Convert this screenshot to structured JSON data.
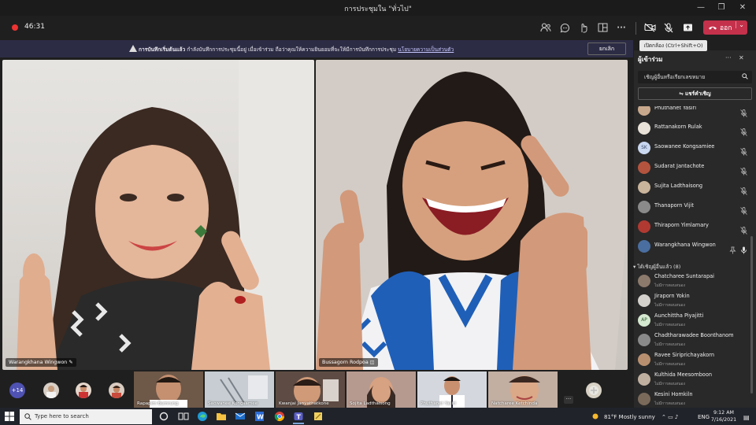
{
  "window": {
    "title": "การประชุมใน \"ทั่วไป\"",
    "minimize": "—",
    "maximize": "❐",
    "close": "✕"
  },
  "toolbar": {
    "timer": "46:31",
    "leave_label": "ออก",
    "leave_chevron": "⌄",
    "more": "···",
    "icons": [
      "people-icon",
      "chat-icon",
      "reactions-icon",
      "rooms-icon",
      "share-icon",
      "camera-icon",
      "mic-icon",
      "share-tray-icon"
    ]
  },
  "tooltip": "เปิดกล้อง (Ctrl+Shift+O)",
  "banner": {
    "bold": "การบันทึกเริ่มต้นแล้ว",
    "text": " กำลังบันทึกการประชุมนี้อยู่ เมื่อเข้าร่วม ถือว่าคุณให้ความยินยอมที่จะให้มีการบันทึกการประชุม ",
    "link": "นโยบายความเป็นส่วนตัว",
    "dismiss": "ยกเลิก"
  },
  "videos": {
    "left_name": "Warangkhana Wingwon",
    "right_name": "Bussagorn Rodpoa"
  },
  "strip": {
    "more_count": "+14",
    "tiles": [
      {
        "name": "Rapapim Bumrung"
      },
      {
        "name": "Saowanee Kongsamee"
      },
      {
        "name": "Kwanjai Janyathatkone"
      },
      {
        "name": "Sojita Ladthaisong"
      },
      {
        "name": "Phuthanet Yasiri"
      },
      {
        "name": "Natcharee Ketchinda"
      }
    ],
    "dots": "···"
  },
  "panel": {
    "title": "ผู้เข้าร่วม",
    "more": "···",
    "close": "✕",
    "invite_placeholder": "เชิญผู้อื่นหรือเรียกเลขหมาย",
    "share_invite": "แชร์คำเชิญ",
    "in_meeting": [
      {
        "name": "Phuthanet Yasiri",
        "initials": "",
        "color": "#c8a88c"
      },
      {
        "name": "Rattanakorn Rulak",
        "initials": "",
        "color": "#e8e2d8"
      },
      {
        "name": "Saowanee Kongsamiee",
        "initials": "SK",
        "color": "#c9d7ef"
      },
      {
        "name": "Sudarat Jantachote",
        "initials": "",
        "color": "#b4543e"
      },
      {
        "name": "Sujita Ladthaisong",
        "initials": "",
        "color": "#c9b49c"
      },
      {
        "name": "Thanaporn Vijit",
        "initials": "",
        "color": "#8a8a8a"
      },
      {
        "name": "Thiraporn Yimlamary",
        "initials": "",
        "color": "#b03a32"
      },
      {
        "name": "Warangkhana Wingwon",
        "initials": "",
        "color": "#4a6ea0"
      }
    ],
    "invited_header": "ได้เชิญผู้อื่นแล้ว (8)",
    "invited": [
      {
        "name": "Chatcharee Suntarapai",
        "sub": "ไม่มีการตอบสนอง",
        "initials": "",
        "color": "#8c7a6c"
      },
      {
        "name": "Jiraporn Yokin",
        "sub": "ไม่มีการตอบสนอง",
        "initials": "",
        "color": "#d4d0cc"
      },
      {
        "name": "Aunchittha Piyajitti",
        "sub": "ไม่มีการตอบสนอง",
        "initials": "AP",
        "color": "#d5e8d0"
      },
      {
        "name": "Chadtharawadee Boonthanom",
        "sub": "ไม่มีการตอบสนอง",
        "initials": "",
        "color": "#8a8a8a"
      },
      {
        "name": "Ravee Siriprichayakorn",
        "sub": "ไม่มีการตอบสนอง",
        "initials": "",
        "color": "#b89070"
      },
      {
        "name": "Kulthida Meesomboon",
        "sub": "ไม่มีการตอบสนอง",
        "initials": "",
        "color": "#c0b0a0"
      },
      {
        "name": "Kesini Homkiln",
        "sub": "ไม่มีการตอบสนอง",
        "initials": "",
        "color": "#7a6a5a"
      }
    ]
  },
  "taskbar": {
    "search_placeholder": "Type here to search",
    "weather": "81°F  Mostly sunny",
    "lang": "ENG",
    "time": "9:12 AM",
    "date": "7/16/2021"
  }
}
